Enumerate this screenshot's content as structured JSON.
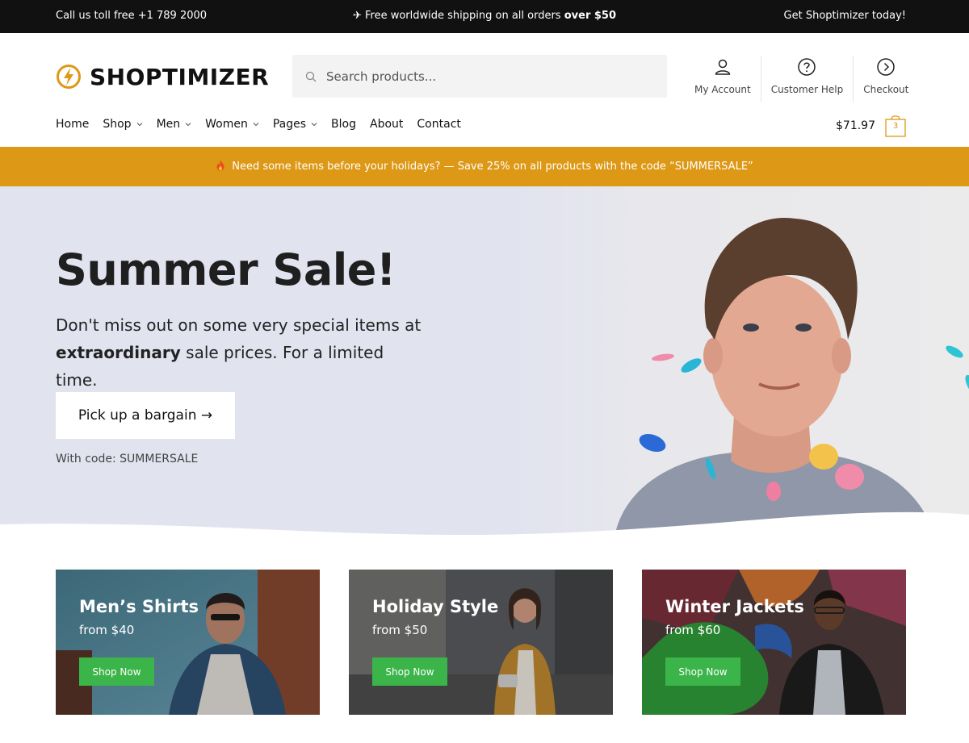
{
  "topbar": {
    "left": "Call us toll free +1 789 2000",
    "center_prefix": "✈ Free worldwide shipping on all orders ",
    "center_bold": "over $50",
    "right": "Get Shoptimizer today!"
  },
  "header": {
    "logo_text": "SHOPTIMIZER",
    "search_placeholder": "Search products...",
    "links": [
      {
        "label": "My Account",
        "icon": "user-icon"
      },
      {
        "label": "Customer Help",
        "icon": "help-icon"
      },
      {
        "label": "Checkout",
        "icon": "arrow-right-circle-icon"
      }
    ],
    "cart_total": "$71.97",
    "cart_count": "3"
  },
  "nav": {
    "items": [
      {
        "label": "Home",
        "has_dropdown": false
      },
      {
        "label": "Shop",
        "has_dropdown": true
      },
      {
        "label": "Men",
        "has_dropdown": true
      },
      {
        "label": "Women",
        "has_dropdown": true
      },
      {
        "label": "Pages",
        "has_dropdown": true
      },
      {
        "label": "Blog",
        "has_dropdown": false
      },
      {
        "label": "About",
        "has_dropdown": false
      },
      {
        "label": "Contact",
        "has_dropdown": false
      }
    ]
  },
  "promo": {
    "icon": "fire-icon",
    "text": "Need some items before your holidays? — Save 25% on all products with the code “SUMMERSALE”"
  },
  "hero": {
    "title": "Summer Sale!",
    "sub_line1": "Don't miss out on some very special items at",
    "sub_bold": "extraordinary",
    "sub_rest": " sale prices. For a limited time.",
    "cta": "Pick up a bargain →",
    "code": "With code: SUMMERSALE"
  },
  "cards": [
    {
      "title": "Men’s Shirts",
      "price": "from $40",
      "button": "Shop Now"
    },
    {
      "title": "Holiday Style",
      "price": "from $50",
      "button": "Shop Now"
    },
    {
      "title": "Winter Jackets",
      "price": "from $60",
      "button": "Shop Now"
    }
  ],
  "colors": {
    "topbar": "#111111",
    "promo": "#dd9816",
    "hero_bg": "#e1e3ef",
    "shop_button": "#3bb54a",
    "accent": "#dd9816"
  }
}
